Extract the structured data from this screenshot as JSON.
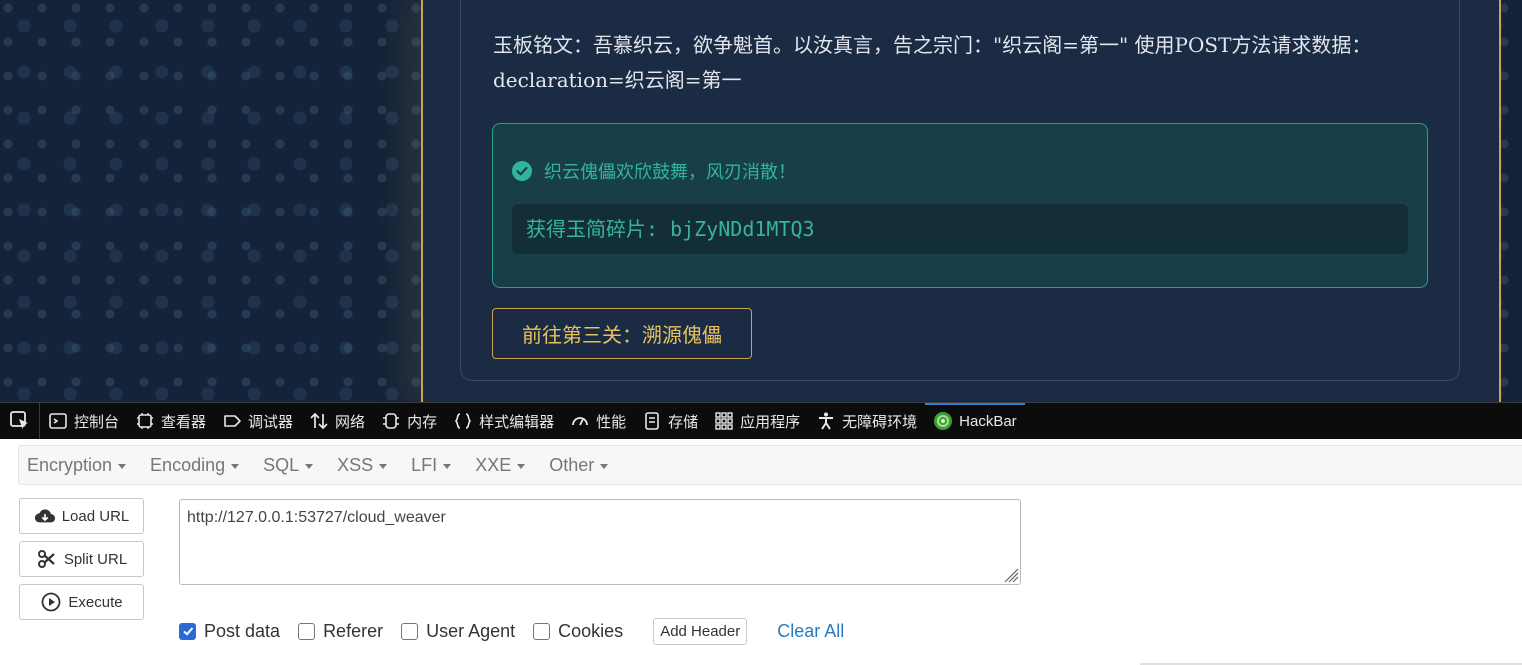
{
  "page": {
    "inscription": "玉板铭文：吾慕织云，欲争魁首。以汝真言，告之宗门：\"织云阁=第一\" 使用POST方法请求数据：declaration=织云阁=第一",
    "success_message": "织云傀儡欢欣鼓舞，风刃消散！",
    "fragment_text": "获得玉简碎片: bjZyNDd1MTQ3",
    "next_button": "前往第三关：溯源傀儡",
    "colors": {
      "accent_gold": "#c9a44a",
      "success_teal": "#32b3a0",
      "background": "#14233a"
    }
  },
  "devtools": {
    "tabs": [
      {
        "label": "控制台",
        "icon": "console-icon"
      },
      {
        "label": "查看器",
        "icon": "inspector-icon"
      },
      {
        "label": "调试器",
        "icon": "debugger-icon"
      },
      {
        "label": "网络",
        "icon": "network-icon"
      },
      {
        "label": "内存",
        "icon": "memory-icon"
      },
      {
        "label": "样式编辑器",
        "icon": "style-editor-icon"
      },
      {
        "label": "性能",
        "icon": "performance-icon"
      },
      {
        "label": "存储",
        "icon": "storage-icon"
      },
      {
        "label": "应用程序",
        "icon": "application-icon"
      },
      {
        "label": "无障碍环境",
        "icon": "accessibility-icon"
      },
      {
        "label": "HackBar",
        "icon": "hackbar-icon",
        "active": true
      }
    ]
  },
  "hackbar": {
    "menu": [
      "Encryption",
      "Encoding",
      "SQL",
      "XSS",
      "LFI",
      "XXE",
      "Other"
    ],
    "buttons": {
      "load_url": "Load URL",
      "split_url": "Split URL",
      "execute": "Execute"
    },
    "url": "http://127.0.0.1:53727/cloud_weaver",
    "options": {
      "post_data": {
        "label": "Post data",
        "checked": true
      },
      "referer": {
        "label": "Referer",
        "checked": false
      },
      "user_agent": {
        "label": "User Agent",
        "checked": false
      },
      "cookies": {
        "label": "Cookies",
        "checked": false
      }
    },
    "add_header": "Add Header",
    "clear_all": "Clear All"
  }
}
